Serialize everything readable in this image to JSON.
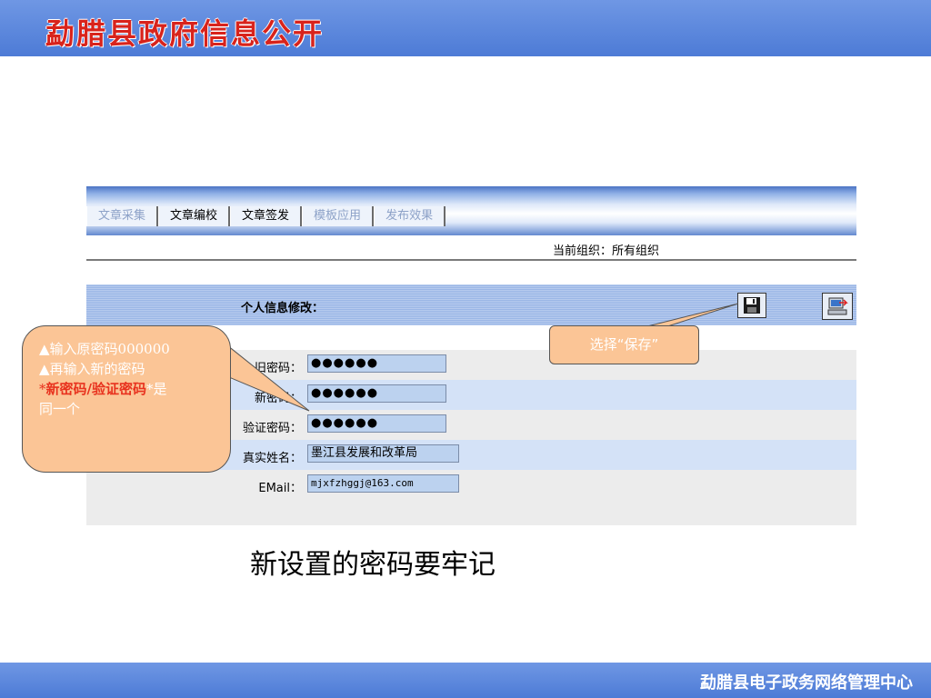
{
  "header": {
    "title": "勐腊县政府信息公开"
  },
  "footer": {
    "text": "勐腊县电子政务网络管理中心"
  },
  "nav": {
    "tabs": [
      {
        "label": "文章采集",
        "enabled": false
      },
      {
        "label": "文章编校",
        "enabled": true
      },
      {
        "label": "文章签发",
        "enabled": true
      },
      {
        "label": "模板应用",
        "enabled": false
      },
      {
        "label": "发布效果",
        "enabled": false
      }
    ]
  },
  "org": {
    "label": "当前组织：所有组织"
  },
  "panel": {
    "title": "个人信息修改：",
    "save_icon": "floppy-disk-icon",
    "exit_icon": "exit-computer-icon"
  },
  "form": {
    "old_password": {
      "label": "旧密码：",
      "value": "●●●●●●"
    },
    "new_password": {
      "label": "新密码：",
      "value": "●●●●●●"
    },
    "confirm_password": {
      "label": "验证密码：",
      "value": "●●●●●●"
    },
    "real_name": {
      "label": "真实姓名：",
      "value": "墨江县发展和改革局"
    },
    "email": {
      "label": "EMail：",
      "value": "mjxfzhggj@163.com"
    }
  },
  "callouts": {
    "left": {
      "line1": "▲输入原密码000000",
      "line2": "▲再输入新的密码",
      "line3_star_a": "*",
      "line3_red": "新密码/验证密码",
      "line3_star_b": "*是",
      "line4": "同一个"
    },
    "right": "选择“保存”"
  },
  "caption": "新设置的密码要牢记",
  "colors": {
    "header_bar": "#5b86dc",
    "title_red": "#d8231c",
    "callout_fill": "#fbc596",
    "highlight_red": "#e8321e"
  }
}
